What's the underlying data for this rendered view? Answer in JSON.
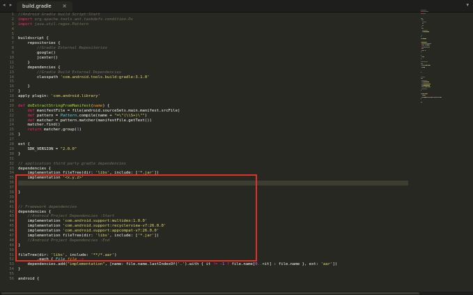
{
  "tabbar": {
    "nav_arrows": "◂ ▸",
    "tab_title": "build.gradle",
    "tab_close": "×",
    "dropdown": "▾"
  },
  "editor": {
    "cursor_line": 36,
    "lines": [
      [
        [
          "c",
          "//Android Gradle build Script:Start"
        ]
      ],
      [
        [
          "k",
          "import "
        ],
        [
          "c",
          "org.apache.tools.ant.taskdefs.condition.Os"
        ]
      ],
      [
        [
          "k",
          "import "
        ],
        [
          "c",
          "java.util.regex.Pattern"
        ]
      ],
      [],
      [],
      [
        [
          "p",
          "buildscript {"
        ]
      ],
      [
        [
          "p",
          "    repositories {"
        ]
      ],
      [
        [
          "c",
          "        //Gradle External Repositories"
        ]
      ],
      [
        [
          "p",
          "        google()"
        ]
      ],
      [
        [
          "p",
          "        jcenter()"
        ]
      ],
      [
        [
          "p",
          "    }"
        ]
      ],
      [
        [
          "p",
          "    dependencies {"
        ]
      ],
      [
        [
          "c",
          "        //Gradle Build External Dependencies"
        ]
      ],
      [
        [
          "p",
          "        classpath "
        ],
        [
          "s",
          "'com.android.tools.build:gradle:3.1.0'"
        ]
      ],
      [],
      [
        [
          "p",
          "    }"
        ]
      ],
      [
        [
          "p",
          "}"
        ]
      ],
      [
        [
          "p",
          "apply plugin: "
        ],
        [
          "s",
          "'com.android.library'"
        ]
      ],
      [],
      [
        [
          "k",
          "def "
        ],
        [
          "f",
          "doExtractStringFromManifest"
        ],
        [
          "p",
          "("
        ],
        [
          "v",
          "name"
        ],
        [
          "p",
          ") {"
        ]
      ],
      [
        [
          "p",
          "    "
        ],
        [
          "k",
          "def "
        ],
        [
          "p",
          "manifestFile = file(android.sourceSets.main.manifest.srcFile)"
        ]
      ],
      [
        [
          "p",
          "    "
        ],
        [
          "k",
          "def "
        ],
        [
          "p",
          "pattern = "
        ],
        [
          "t",
          "Pattern"
        ],
        [
          "p",
          ".compile(name + "
        ],
        [
          "s",
          "\"=\\\"(\\\\S+)\\\"\""
        ],
        [
          "p",
          ")"
        ]
      ],
      [
        [
          "p",
          "    "
        ],
        [
          "k",
          "def "
        ],
        [
          "p",
          "matcher = pattern.matcher(manifestFile.getText())"
        ]
      ],
      [
        [
          "p",
          "    matcher.find()"
        ]
      ],
      [
        [
          "p",
          "    "
        ],
        [
          "k",
          "return "
        ],
        [
          "p",
          "matcher.group("
        ],
        [
          "n",
          "1"
        ],
        [
          "p",
          ")"
        ]
      ],
      [
        [
          "p",
          "}"
        ]
      ],
      [],
      [
        [
          "p",
          "ext {"
        ]
      ],
      [
        [
          "p",
          "    SDK_VERSION = "
        ],
        [
          "s",
          "\"2.0.0\""
        ]
      ],
      [
        [
          "p",
          "}"
        ]
      ],
      [],
      [
        [
          "c",
          "// application third party gradle dependencies"
        ]
      ],
      [
        [
          "p",
          "dependencies {"
        ]
      ],
      [
        [
          "p",
          "    implementation fileTree(dir: "
        ],
        [
          "s",
          "'libs'"
        ],
        [
          "p",
          ", include: ["
        ],
        [
          "s",
          "'*.jar'"
        ],
        [
          "p",
          "])"
        ]
      ],
      [
        [
          "p",
          "    implementation "
        ],
        [
          "s",
          "'<x.y.z>'"
        ]
      ],
      [],
      [],
      [
        [
          "p",
          "}"
        ]
      ],
      [],
      [],
      [
        [
          "c",
          "// Framework dependencies"
        ]
      ],
      [
        [
          "p",
          "dependencies {"
        ]
      ],
      [
        [
          "c",
          "    //Android Project Dependencies :Start"
        ]
      ],
      [
        [
          "p",
          "    implementation "
        ],
        [
          "s",
          "'com.android.support:multidex:1.0.0'"
        ]
      ],
      [
        [
          "p",
          "    implementation "
        ],
        [
          "s",
          "'com.android.support:recyclerview-v7:26.0.0'"
        ]
      ],
      [
        [
          "p",
          "    implementation "
        ],
        [
          "s",
          "'com.android.support:appcompat-v7:26.0.0'"
        ]
      ],
      [
        [
          "p",
          "    implementation fileTree(dir: "
        ],
        [
          "s",
          "'libs'"
        ],
        [
          "p",
          ", include: ["
        ],
        [
          "s",
          "'*.jar'"
        ],
        [
          "p",
          "])"
        ]
      ],
      [
        [
          "c",
          "    //Android Project Dependencies :End"
        ]
      ],
      [
        [
          "p",
          "}"
        ]
      ],
      [],
      [
        [
          "p",
          "fileTree(dir: "
        ],
        [
          "s",
          "'libs'"
        ],
        [
          "p",
          ", include: "
        ],
        [
          "s",
          "'**/*.aar'"
        ],
        [
          "p",
          ")"
        ]
      ],
      [
        [
          "p",
          "        .each { "
        ],
        [
          "t",
          "File "
        ],
        [
          "v",
          "file "
        ],
        [
          "k",
          "->"
        ]
      ],
      [
        [
          "p",
          "    dependencies.add("
        ],
        [
          "s",
          "\"implementation\""
        ],
        [
          "p",
          ", [name: file.name.lastIndexOf("
        ],
        [
          "s",
          "'.'"
        ],
        [
          "p",
          ").with { it "
        ],
        [
          "k",
          "!= "
        ],
        [
          "n",
          "-1"
        ],
        [
          "k",
          " ? "
        ],
        [
          "p",
          "file.name["
        ],
        [
          "n",
          "0"
        ],
        [
          "k",
          ".."
        ],
        [
          "p",
          "<it] : file.name }, ext: "
        ],
        [
          "s",
          "'aar'"
        ],
        [
          "p",
          "])"
        ]
      ],
      [
        [
          "p",
          "}"
        ]
      ],
      [],
      [
        [
          "p",
          "android {"
        ]
      ]
    ]
  },
  "colors": {
    "background": "#272822",
    "comment": "#75715e",
    "keyword": "#f92672",
    "string": "#e6db74",
    "function": "#a6e22e",
    "number": "#ae81ff",
    "type": "#66d9ef",
    "parameter": "#fd971f",
    "annotation_box": "#e0312a"
  }
}
